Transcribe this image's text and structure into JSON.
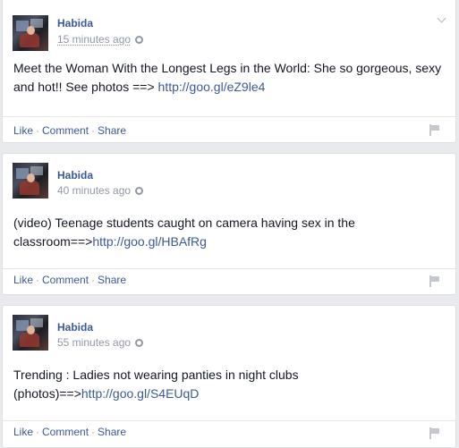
{
  "posts": [
    {
      "author": "Habida",
      "time": "15 minutes ago",
      "text_pre": "Meet the Woman With the Longest Legs in the World: She so gorgeous, sexy and hot!! See photos ==> ",
      "link": "http://goo.gl/eZ9le4",
      "actions": {
        "like": "Like",
        "comment": "Comment",
        "share": "Share"
      }
    },
    {
      "author": "Habida",
      "time": "40 minutes ago",
      "text_pre": "(video) Teenage students caught on camera having sex in the classroom==>",
      "link": "http://goo.gl/HBAfRg",
      "actions": {
        "like": "Like",
        "comment": "Comment",
        "share": "Share"
      }
    },
    {
      "author": "Habida",
      "time": "55 minutes ago",
      "text_pre": "Trending : Ladies not wearing panties in night clubs (photos)==>",
      "link": "http://goo.gl/S4EUqD",
      "actions": {
        "like": "Like",
        "comment": "Comment",
        "share": "Share"
      }
    }
  ],
  "separator": "·",
  "icons": [
    "globe-icon",
    "chevron-down-icon",
    "flag-icon"
  ],
  "colors": {
    "link": "#3b5998",
    "muted": "#9197a3",
    "text": "#141823",
    "background": "#e9eaed"
  }
}
